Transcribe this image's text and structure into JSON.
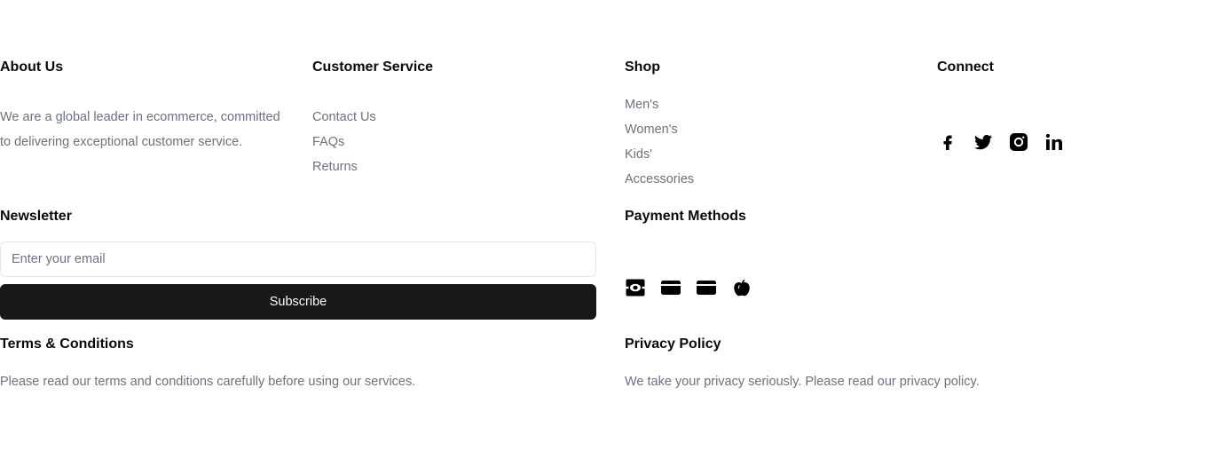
{
  "about": {
    "heading": "About Us",
    "text": "We are a global leader in ecommerce, committed to delivering exceptional customer service."
  },
  "customer_service": {
    "heading": "Customer Service",
    "links": [
      "Contact Us",
      "FAQs",
      "Returns"
    ]
  },
  "shop": {
    "heading": "Shop",
    "links": [
      "Men's",
      "Women's",
      "Kids'",
      "Accessories"
    ]
  },
  "connect": {
    "heading": "Connect",
    "icons": [
      "facebook-icon",
      "twitter-icon",
      "instagram-icon",
      "linkedin-icon"
    ]
  },
  "newsletter": {
    "heading": "Newsletter",
    "placeholder": "Enter your email",
    "button_label": "Subscribe"
  },
  "payment": {
    "heading": "Payment Methods",
    "icons": [
      "cash-icon",
      "credit-card-icon",
      "debit-card-icon",
      "apple-pay-icon"
    ]
  },
  "terms": {
    "heading": "Terms & Conditions",
    "text": "Please read our terms and conditions carefully before using our services."
  },
  "privacy": {
    "heading": "Privacy Policy",
    "text": "We take your privacy seriously. Please read our privacy policy."
  },
  "colors": {
    "heading": "#0a0a0a",
    "muted": "#6b7280",
    "button_bg": "#18181b",
    "button_text": "#fafafa",
    "input_border": "#e5e7eb"
  }
}
